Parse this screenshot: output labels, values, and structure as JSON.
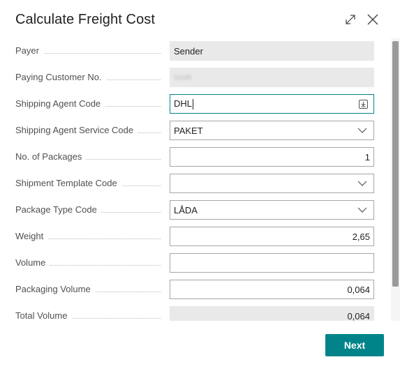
{
  "dialog": {
    "title": "Calculate Freight Cost",
    "expand_icon": "expand-icon",
    "close_icon": "close-icon"
  },
  "fields": {
    "payer": {
      "label": "Payer",
      "value": "Sender"
    },
    "paying_customer_no": {
      "label": "Paying Customer No.",
      "value": "10189"
    },
    "shipping_agent_code": {
      "label": "Shipping Agent Code",
      "value": "DHL"
    },
    "shipping_agent_service_code": {
      "label": "Shipping Agent Service Code",
      "value": "PAKET"
    },
    "no_of_packages": {
      "label": "No. of Packages",
      "value": "1"
    },
    "shipment_template_code": {
      "label": "Shipment Template Code",
      "value": ""
    },
    "package_type_code": {
      "label": "Package Type Code",
      "value": "LÅDA"
    },
    "weight": {
      "label": "Weight",
      "value": "2,65"
    },
    "volume": {
      "label": "Volume",
      "value": ""
    },
    "packaging_volume": {
      "label": "Packaging Volume",
      "value": "0,064"
    },
    "total_volume": {
      "label": "Total Volume",
      "value": "0,064"
    }
  },
  "actions": {
    "next_label": "Next"
  },
  "colors": {
    "accent": "#00848a",
    "focus_border": "#008489",
    "readonly_bg": "#e9e9e9"
  }
}
